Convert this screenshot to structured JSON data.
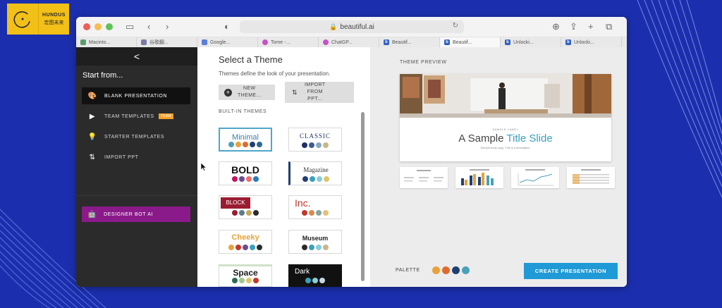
{
  "logo": {
    "line1": "HUNDUS",
    "line2": "宏图未来"
  },
  "browser": {
    "url": "beautiful.ai",
    "tabs": [
      {
        "label": "Macinto...",
        "color": "#5a9c6e"
      },
      {
        "label": "谷歌翻...",
        "color": "#7a7aa8"
      },
      {
        "label": "Google...",
        "color": "#5b7fd6"
      },
      {
        "label": "Tome -...",
        "color": "#c84fc8"
      },
      {
        "label": "ChatGP...",
        "color": "#c84fc8"
      },
      {
        "label": "Beautif...",
        "color": "#2f5fbf"
      },
      {
        "label": "Beautif...",
        "color": "#2f5fbf",
        "active": true
      },
      {
        "label": "Unlocki...",
        "color": "#2f5fbf"
      },
      {
        "label": "Unlocki...",
        "color": "#2f5fbf"
      }
    ]
  },
  "sidebar": {
    "back": "<",
    "start": "Start from...",
    "items": [
      {
        "label": "BLANK PRESENTATION",
        "icon": "palette-icon"
      },
      {
        "label": "TEAM TEMPLATES",
        "icon": "play-icon",
        "badge": "TEAM"
      },
      {
        "label": "STARTER TEMPLATES",
        "icon": "bulb-icon"
      },
      {
        "label": "IMPORT PPT",
        "icon": "import-icon"
      }
    ],
    "bot": "DESIGNER BOT AI"
  },
  "themes": {
    "title": "Select a Theme",
    "subtitle": "Themes define the look of your presentation.",
    "new_label": "NEW\nTHEME...",
    "import_label": "IMPORT\nFROM\nPPT...",
    "section": "BUILT-IN THEMES",
    "cards": [
      {
        "name": "Minimal",
        "colors": [
          "#4aa0b8",
          "#e9a23b",
          "#e06a2e",
          "#1f3f73",
          "#2a6a8c"
        ]
      },
      {
        "name": "CLASSIC",
        "colors": [
          "#1f2f63",
          "#3d5c8c",
          "#8aa9b8",
          "#c8b78a"
        ]
      },
      {
        "name": "BOLD",
        "colors": [
          "#c2185b",
          "#6a4c93",
          "#ef6c6c",
          "#2b7bb9"
        ]
      },
      {
        "name": "Magazine",
        "colors": [
          "#1f3f73",
          "#3aa0bd",
          "#8ccbd6",
          "#e0c36a"
        ]
      },
      {
        "name": "BLOCK",
        "colors": [
          "#9b1c31",
          "#5c7c8a",
          "#c7a657",
          "#2b2b2b"
        ]
      },
      {
        "name": "Inc.",
        "colors": [
          "#c0392b",
          "#d98a4b",
          "#7fa7a0",
          "#e8c070"
        ]
      },
      {
        "name": "Cheeky",
        "colors": [
          "#e9a23b",
          "#c0392b",
          "#6a4c93",
          "#3aa0bd",
          "#2b2b2b"
        ]
      },
      {
        "name": "Museum",
        "colors": [
          "#2b2b2b",
          "#3aa0bd",
          "#8ccbd6",
          "#c8b78a"
        ]
      },
      {
        "name": "Space",
        "colors": [
          "#2b6a4f",
          "#9ec98a",
          "#e0c36a",
          "#c0392b"
        ]
      },
      {
        "name": "Dark",
        "colors": [
          "#3aa0bd",
          "#8ccbd6",
          "#c8d8e0"
        ]
      }
    ]
  },
  "preview": {
    "label": "THEME PREVIEW",
    "small": "SAMPLE LABEL",
    "title_a": "A Sample ",
    "title_b": "Title Slide",
    "body": "Sample body copy. This is a description.",
    "palette_label": "PALETTE",
    "palette": [
      "#e9a23b",
      "#e06a2e",
      "#1f3f73",
      "#4aa0b8"
    ],
    "create": "CREATE PRESENTATION"
  }
}
